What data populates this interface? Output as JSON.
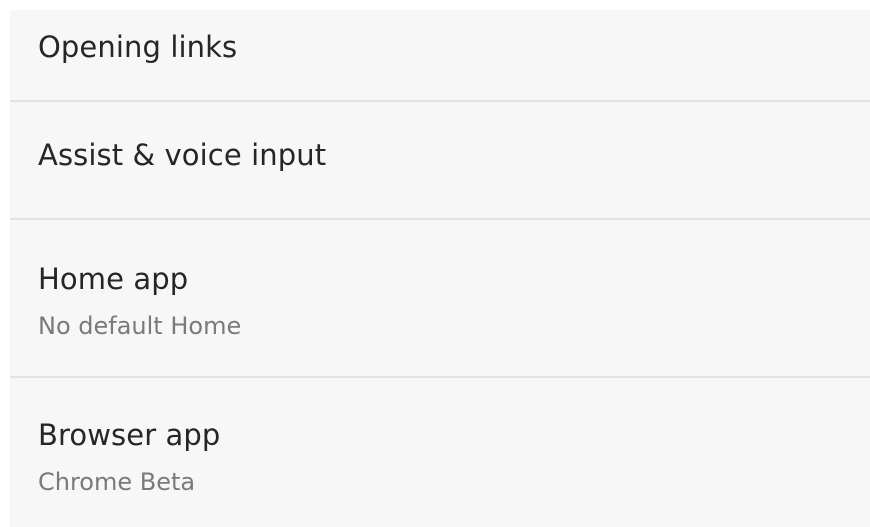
{
  "settings": {
    "items": [
      {
        "title": "Opening links",
        "summary": ""
      },
      {
        "title": "Assist & voice input",
        "summary": ""
      },
      {
        "title": "Home app",
        "summary": "No default Home"
      },
      {
        "title": "Browser app",
        "summary": "Chrome Beta"
      }
    ]
  },
  "colors": {
    "background": "#f7f7f7",
    "divider": "#e2e2e2",
    "title_text": "#262626",
    "summary_text": "#7a7a7a"
  }
}
